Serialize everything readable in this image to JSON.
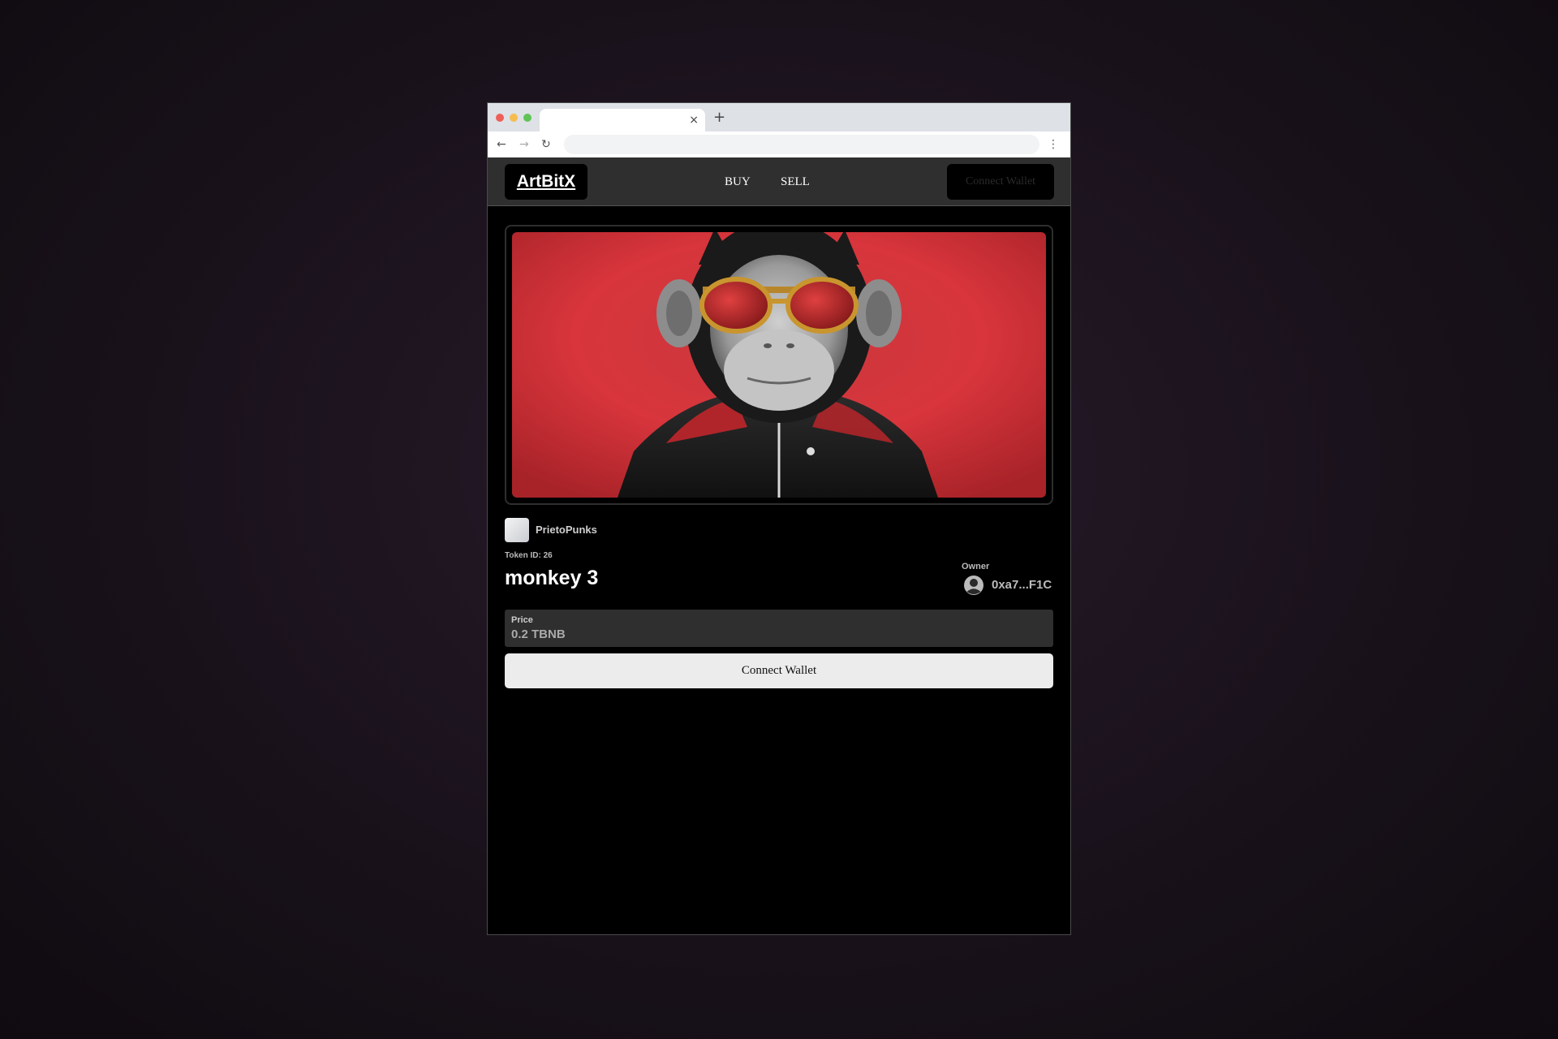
{
  "browser": {
    "tab_close": "×",
    "new_tab": "+",
    "back": "←",
    "forward": "→",
    "reload": "↻",
    "menu": "⋮"
  },
  "header": {
    "logo": "ArtBitX",
    "nav": [
      {
        "label": "BUY"
      },
      {
        "label": "SELL"
      }
    ],
    "connect_wallet": "Connect Wallet"
  },
  "nft": {
    "collection": "PrietoPunks",
    "token_id": "Token ID: 26",
    "title": "monkey 3",
    "owner_label": "Owner",
    "owner_address": "0xa7...F1C",
    "price_label": "Price",
    "price_value": "0.2 TBNB",
    "image_subject": "monkey-with-red-sunglasses"
  },
  "actions": {
    "connect_wallet": "Connect Wallet"
  },
  "colors": {
    "accent_red": "#d8353c",
    "header_bg": "#2f2f2f",
    "page_bg": "#000000"
  }
}
